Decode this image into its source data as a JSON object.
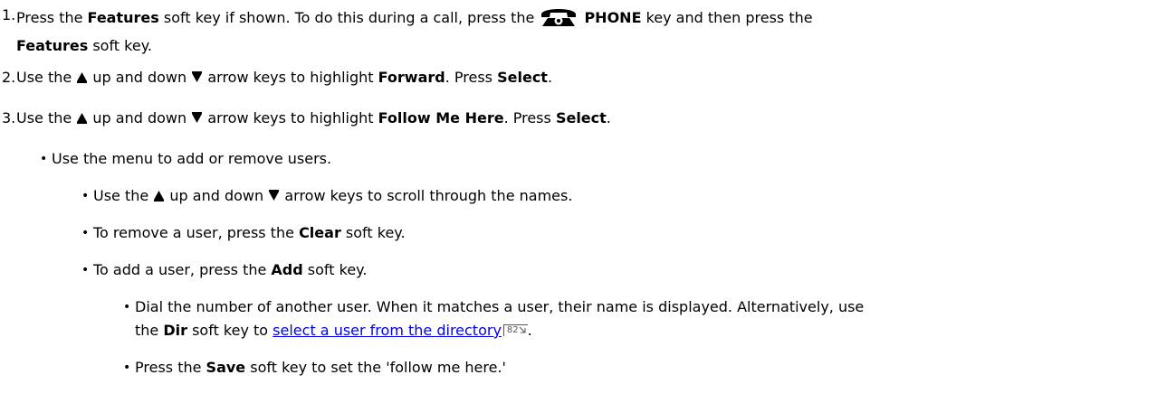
{
  "steps": [
    {
      "num": "1.",
      "t1": "Press the ",
      "b1": "Features",
      "t2": " soft key if shown. To do this during a call, press the ",
      "icon": "phone-icon",
      "b2": "PHONE",
      "t3": " key and then press the",
      "b3": "Features",
      "t4": " soft key."
    },
    {
      "num": "2.",
      "t1": "Use the ",
      "t2": " up and down ",
      "t3": " arrow keys to highlight ",
      "b1": "Forward",
      "t4": ". Press ",
      "b2": "Select",
      "t5": "."
    },
    {
      "num": "3.",
      "t1": "Use the ",
      "t2": " up and down ",
      "t3": " arrow keys to highlight ",
      "b1": "Follow Me Here",
      "t4": ". Press ",
      "b2": "Select",
      "t5": "."
    }
  ],
  "bullets": {
    "menu": "Use the menu to add or remove users.",
    "scroll": {
      "t1": "Use the ",
      "t2": " up and down ",
      "t3": " arrow keys to scroll through the names."
    },
    "remove": {
      "t1": "To remove a user, press the ",
      "b1": "Clear",
      "t2": " soft key."
    },
    "add": {
      "t1": "To add a user, press the ",
      "b1": "Add",
      "t2": " soft key."
    },
    "dial": {
      "t1": "Dial the number of another user. When it matches a user, their name is displayed.  Alternatively, use",
      "t2": "the ",
      "b1": "Dir",
      "t3": " soft key to ",
      "link": "select a user from the directory",
      "pageref": "82",
      "t4": "."
    },
    "save": {
      "t1": "Press the ",
      "b1": "Save",
      "t2": " soft key to set the 'follow me here.'"
    }
  },
  "bullet_char": "•",
  "icons": {
    "up": "up-arrow-icon",
    "down": "down-arrow-icon",
    "pageref": "page-reference-icon"
  }
}
